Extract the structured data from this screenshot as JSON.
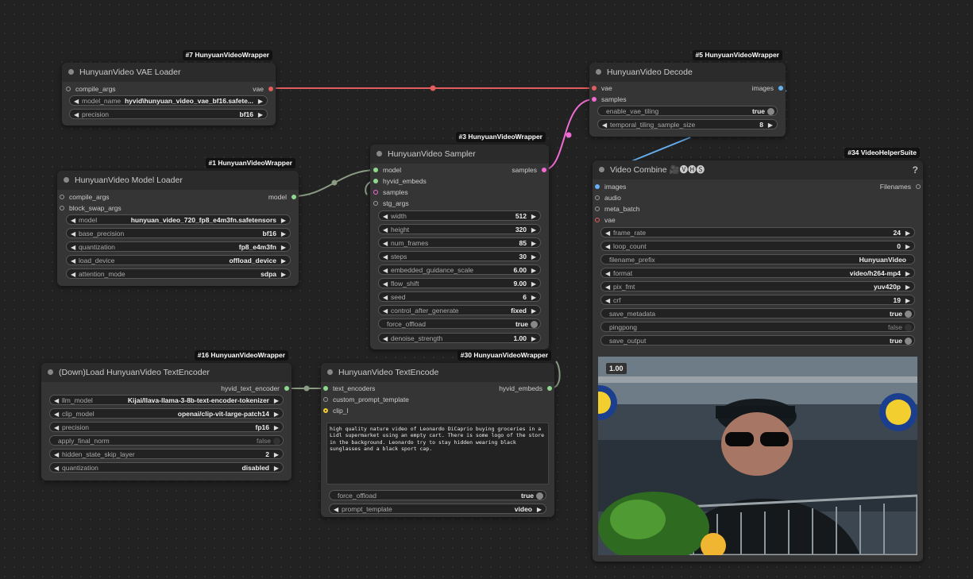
{
  "colors": {
    "vae_link": "#e25d5d",
    "model_link": "#8a9a83",
    "latent_link": "#f06bd3",
    "image_link": "#64b0f0",
    "encoder_link": "#8a9a83"
  },
  "nodes": {
    "vae_loader": {
      "badge": "#7 HunyuanVideoWrapper",
      "title": "HunyuanVideo VAE Loader",
      "inputs": [
        "compile_args"
      ],
      "outputs": [
        "vae"
      ],
      "widgets": [
        {
          "label": "model_name",
          "value": "hyvid\\hunyuan_video_vae_bf16.safete..."
        },
        {
          "label": "precision",
          "value": "bf16"
        }
      ]
    },
    "model_loader": {
      "badge": "#1 HunyuanVideoWrapper",
      "title": "HunyuanVideo Model Loader",
      "inputs": [
        "compile_args",
        "block_swap_args"
      ],
      "outputs": [
        "model"
      ],
      "widgets": [
        {
          "label": "model",
          "value": "hunyuan_video_720_fp8_e4m3fn.safetensors"
        },
        {
          "label": "base_precision",
          "value": "bf16"
        },
        {
          "label": "quantization",
          "value": "fp8_e4m3fn"
        },
        {
          "label": "load_device",
          "value": "offload_device"
        },
        {
          "label": "attention_mode",
          "value": "sdpa"
        }
      ]
    },
    "sampler": {
      "badge": "#3 HunyuanVideoWrapper",
      "title": "HunyuanVideo Sampler",
      "inputs": [
        "model",
        "hyvid_embeds",
        "samples",
        "stg_args"
      ],
      "outputs": [
        "samples"
      ],
      "widgets": [
        {
          "label": "width",
          "value": "512"
        },
        {
          "label": "height",
          "value": "320"
        },
        {
          "label": "num_frames",
          "value": "85"
        },
        {
          "label": "steps",
          "value": "30"
        },
        {
          "label": "embedded_guidance_scale",
          "value": "6.00"
        },
        {
          "label": "flow_shift",
          "value": "9.00"
        },
        {
          "label": "seed",
          "value": "6"
        },
        {
          "label": "control_after_generate",
          "value": "fixed"
        },
        {
          "label": "force_offload",
          "value": "true"
        },
        {
          "label": "denoise_strength",
          "value": "1.00"
        }
      ]
    },
    "decode": {
      "badge": "#5 HunyuanVideoWrapper",
      "title": "HunyuanVideo Decode",
      "inputs": [
        "vae",
        "samples"
      ],
      "outputs": [
        "images"
      ],
      "widgets": [
        {
          "label": "enable_vae_tiling",
          "value": "true"
        },
        {
          "label": "temporal_tiling_sample_size",
          "value": "8"
        }
      ]
    },
    "video_combine": {
      "badge": "#34 VideoHelperSuite",
      "title": "Video Combine 🎥🅥🅗🅢",
      "help": "?",
      "inputs": [
        "images",
        "audio",
        "meta_batch",
        "vae"
      ],
      "outputs": [
        "Filenames"
      ],
      "widgets": [
        {
          "label": "frame_rate",
          "value": "24"
        },
        {
          "label": "loop_count",
          "value": "0"
        },
        {
          "label": "filename_prefix",
          "value": "HunyuanVideo"
        },
        {
          "label": "format",
          "value": "video/h264-mp4"
        },
        {
          "label": "pix_fmt",
          "value": "yuv420p"
        },
        {
          "label": "crf",
          "value": "19"
        },
        {
          "label": "save_metadata",
          "value": "true"
        },
        {
          "label": "pingpong",
          "value": "false"
        },
        {
          "label": "save_output",
          "value": "true"
        }
      ],
      "preview_label": "1.00"
    },
    "text_encoder_loader": {
      "badge": "#16 HunyuanVideoWrapper",
      "title": "(Down)Load HunyuanVideo TextEncoder",
      "outputs": [
        "hyvid_text_encoder"
      ],
      "widgets": [
        {
          "label": "llm_model",
          "value": "Kijai/llava-llama-3-8b-text-encoder-tokenizer"
        },
        {
          "label": "clip_model",
          "value": "openai/clip-vit-large-patch14"
        },
        {
          "label": "precision",
          "value": "fp16"
        },
        {
          "label": "apply_final_norm",
          "value": "false"
        },
        {
          "label": "hidden_state_skip_layer",
          "value": "2"
        },
        {
          "label": "quantization",
          "value": "disabled"
        }
      ]
    },
    "text_encode": {
      "badge": "#30 HunyuanVideoWrapper",
      "title": "HunyuanVideo TextEncode",
      "inputs": [
        "text_encoders",
        "custom_prompt_template",
        "clip_l"
      ],
      "outputs": [
        "hyvid_embeds"
      ],
      "prompt": "high quality nature video of Leonardo DiCaprio buying groceries in a Lidl supermarket using an empty cart. There is some logo of the store in the background. Leonardo try to stay hidden wearing black sunglasses and a black sport cap.",
      "widgets": [
        {
          "label": "force_offload",
          "value": "true"
        },
        {
          "label": "prompt_template",
          "value": "video"
        }
      ]
    }
  }
}
